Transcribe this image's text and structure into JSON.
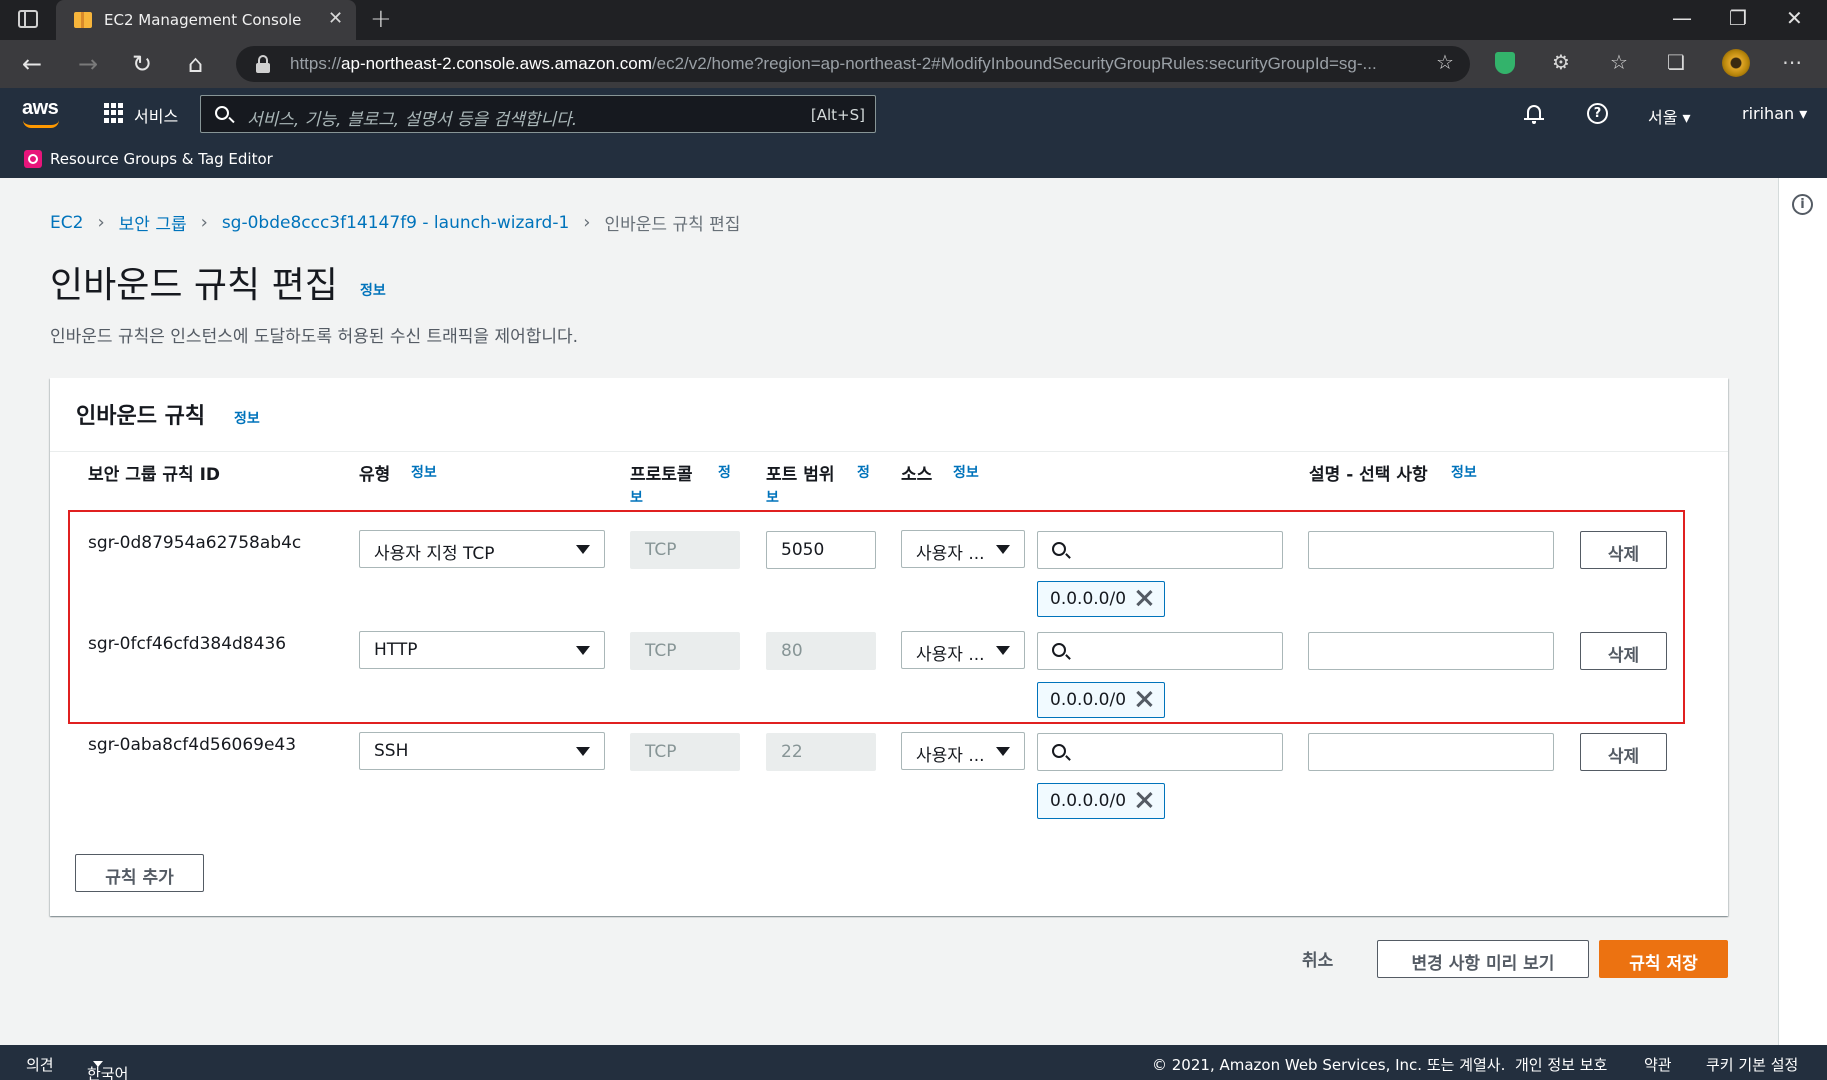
{
  "browser": {
    "tab_title": "EC2 Management Console",
    "url_prefix": "https://",
    "url_host": "ap-northeast-2.console.aws.amazon.com",
    "url_rest": "/ec2/v2/home?region=ap-northeast-2#ModifyInboundSecurityGroupRules:securityGroupId=sg-..."
  },
  "aws_nav": {
    "logo": "aws",
    "services_label": "서비스",
    "search_placeholder": "서비스, 기능, 블로그, 설명서 등을 검색합니다.",
    "search_shortcut": "[Alt+S]",
    "region": "서울",
    "user": "ririhan",
    "favorite": "Resource Groups & Tag Editor"
  },
  "breadcrumb": [
    "EC2",
    "보안 그룹",
    "sg-0bde8ccc3f14147f9 - launch-wizard-1",
    "인바운드 규칙 편집"
  ],
  "page": {
    "title": "인바운드 규칙 편집",
    "info": "정보",
    "description": "인바운드 규칙은 인스턴스에 도달하도록 허용된 수신 트래픽을 제어합니다."
  },
  "card": {
    "title": "인바운드 규칙",
    "info": "정보",
    "columns": {
      "rule_id": "보안 그룹 규칙 ID",
      "type": "유형",
      "protocol": "프로토콜",
      "port": "포트 범위",
      "source": "소스",
      "description": "설명 - 선택 사항"
    },
    "info_label": "정보",
    "info_label_split_1": "정",
    "info_label_split_2": "보",
    "rows": [
      {
        "id": "sgr-0d87954a62758ab4c",
        "type": "사용자 지정 TCP",
        "protocol": "TCP",
        "port": "5050",
        "source_type": "사용자 ...",
        "cidr": "0.0.0.0/0",
        "description": "",
        "delete_label": "삭제"
      },
      {
        "id": "sgr-0fcf46cfd384d8436",
        "type": "HTTP",
        "protocol": "TCP",
        "port": "80",
        "source_type": "사용자 ...",
        "cidr": "0.0.0.0/0",
        "description": "",
        "delete_label": "삭제"
      },
      {
        "id": "sgr-0aba8cf4d56069e43",
        "type": "SSH",
        "protocol": "TCP",
        "port": "22",
        "source_type": "사용자 ...",
        "cidr": "0.0.0.0/0",
        "description": "",
        "delete_label": "삭제"
      }
    ],
    "add_rule_label": "규칙 추가"
  },
  "actions": {
    "cancel": "취소",
    "preview": "변경 사항 미리 보기",
    "save": "규칙 저장"
  },
  "footer": {
    "feedback": "의견",
    "language": "한국어",
    "copyright": "© 2021, Amazon Web Services, Inc. 또는 계열사.",
    "privacy": "개인 정보 보호",
    "terms": "약관",
    "cookies": "쿠키 기본 설정"
  },
  "colors": {
    "aws_nav_bg": "#232f3e",
    "link": "#0073bb",
    "primary_button": "#ec7211",
    "highlight_box": "#e02020"
  }
}
